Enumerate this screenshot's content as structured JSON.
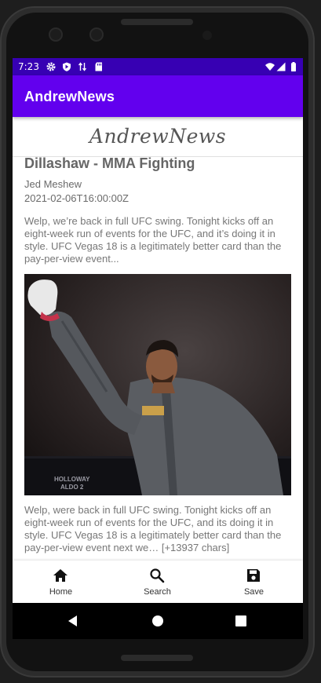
{
  "status_bar": {
    "time": "7:23",
    "left_icons": [
      "gear-icon",
      "shield-icon",
      "data-arrows-icon",
      "sd-card-icon"
    ],
    "right_icons": [
      "wifi-icon",
      "signal-icon",
      "battery-icon"
    ]
  },
  "app_bar": {
    "title": "AndrewNews",
    "color": "#6200ee"
  },
  "logo": {
    "text": "AndrewNews"
  },
  "article": {
    "headline": "Dillashaw - MMA Fighting",
    "author": "Jed Meshew",
    "published_at": "2021-02-06T16:00:00Z",
    "description": "Welp, we’re back in full UFC swing. Tonight kicks off an eight-week run of events for the UFC, and it’s doing it in style. UFC Vegas 18 is a legitimately better card than the pay-per-view event...",
    "image": {
      "alt": "UFC fighter raising a gloved fist wearing grey hoodie",
      "banner_text_1": "HOLLOWAY",
      "banner_text_2": "ALDO 2"
    },
    "content": "Welp, were back in full UFC swing. Tonight kicks off an eight-week run of events for the UFC, and its doing it in style. UFC Vegas 18 is a legitimately better card than the pay-per-view event next we… [+13937 chars]"
  },
  "bottom_nav": [
    {
      "label": "Home",
      "icon": "home-icon"
    },
    {
      "label": "Search",
      "icon": "search-icon"
    },
    {
      "label": "Save",
      "icon": "save-icon"
    }
  ],
  "system_nav": {
    "icons": [
      "back-icon",
      "home-circle-icon",
      "recents-icon"
    ]
  }
}
